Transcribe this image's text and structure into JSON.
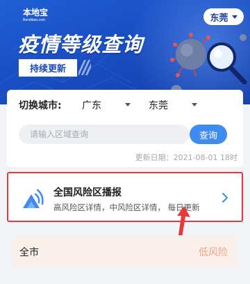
{
  "header": {
    "logo_cn": "本地宝",
    "logo_en": "Bendibao.com",
    "city_button": "东莞",
    "title": "疫情等级查询",
    "subtitle": "持续更新"
  },
  "search_panel": {
    "city_label": "切换城市:",
    "province": "广东",
    "city": "东莞",
    "search_placeholder": "请输入区域查询",
    "search_button": "查询",
    "update_date": "更新日期：2021-08-01 18时"
  },
  "broadcast": {
    "title": "全国风险区播报",
    "description": "高风险区详情，中风险区详情，  每日更新"
  },
  "risk_list": {
    "rows": [
      {
        "area": "全市",
        "level": "低风险"
      }
    ]
  },
  "colors": {
    "banner_blue": "#1a4fc4",
    "accent_blue": "#3f8cf0",
    "highlight_red": "#e8393a",
    "low_risk": "#f0a585"
  }
}
